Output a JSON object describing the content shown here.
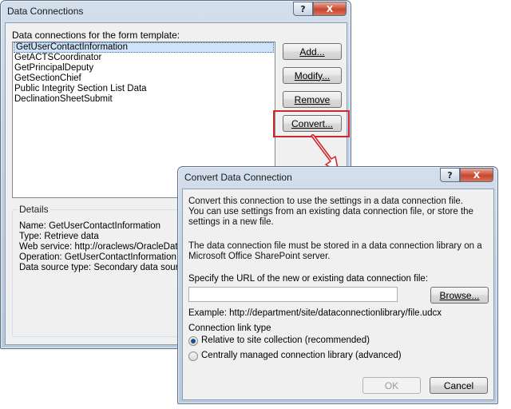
{
  "data_connections": {
    "title": "Data Connections",
    "help_glyph": "?",
    "close_glyph": "X",
    "list_label": "Data connections for the form template:",
    "connections": [
      "GetUserContactInformation",
      "GetACTSCoordinator",
      "GetPrincipalDeputy",
      "GetSectionChief",
      "Public Integrity Section List Data",
      "DeclinationSheetSubmit"
    ],
    "buttons": {
      "add": "Add...",
      "modify": "Modify...",
      "remove": "Remove",
      "convert": "Convert..."
    },
    "details": {
      "legend": "Details",
      "lines": [
        "Name: GetUserContactInformation",
        "Type: Retrieve data",
        "Web service: http://oraclews/OracleData",
        "Operation: GetUserContactInformation",
        "Data source type: Secondary data source"
      ]
    }
  },
  "convert_dialog": {
    "title": "Convert Data Connection",
    "help_glyph": "?",
    "close_glyph": "X",
    "intro_lines": [
      "Convert this connection to use the settings in a data connection file.",
      "You can use settings from an existing data connection file, or store the",
      "settings in a new file."
    ],
    "library_lines": [
      "The data connection file must be stored in a data connection library on a",
      "Microsoft Office SharePoint server."
    ],
    "url_label": "Specify the URL of the new or existing data connection file:",
    "url_value": "",
    "browse_label": "Browse...",
    "example_text": "Example: http://department/site/dataconnectionlibrary/file.udcx",
    "link_type_label": "Connection link type",
    "options": [
      {
        "label": "Relative to site collection (recommended)",
        "checked": true
      },
      {
        "label": "Centrally managed connection library (advanced)",
        "checked": false
      }
    ],
    "ok_label": "OK",
    "cancel_label": "Cancel"
  },
  "colors": {
    "highlight": "#d0272c",
    "title_glass": "#c2d2e4",
    "selection": "#cfe3fb"
  }
}
